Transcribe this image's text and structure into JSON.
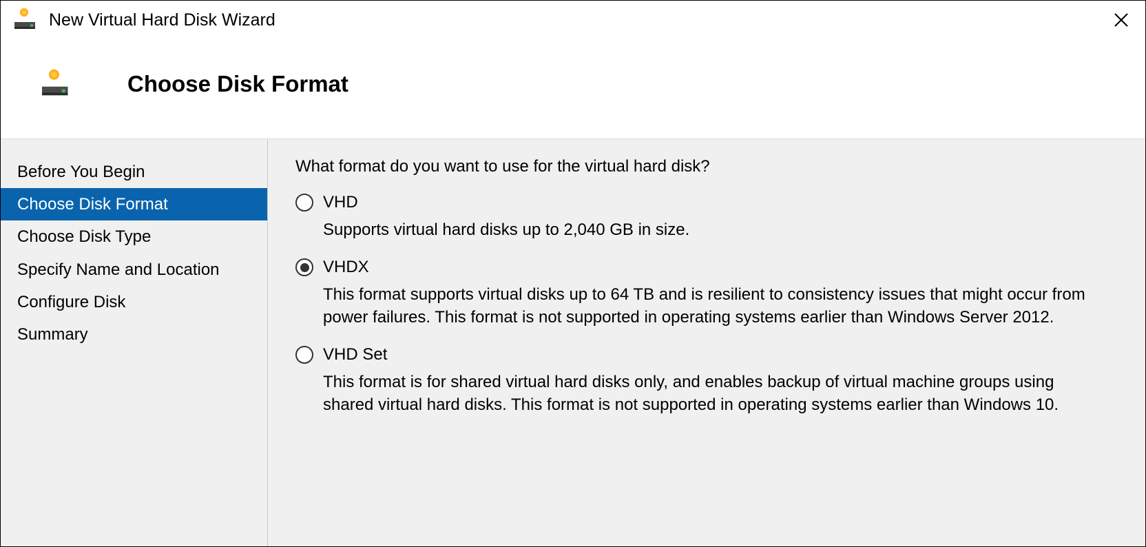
{
  "window": {
    "title": "New Virtual Hard Disk Wizard"
  },
  "header": {
    "heading": "Choose Disk Format"
  },
  "sidebar": {
    "steps": [
      {
        "label": "Before You Begin",
        "active": false
      },
      {
        "label": "Choose Disk Format",
        "active": true
      },
      {
        "label": "Choose Disk Type",
        "active": false
      },
      {
        "label": "Specify Name and Location",
        "active": false
      },
      {
        "label": "Configure Disk",
        "active": false
      },
      {
        "label": "Summary",
        "active": false
      }
    ]
  },
  "content": {
    "question": "What format do you want to use for the virtual hard disk?",
    "options": [
      {
        "id": "vhd",
        "label": "VHD",
        "description": "Supports virtual hard disks up to 2,040 GB in size.",
        "selected": false
      },
      {
        "id": "vhdx",
        "label": "VHDX",
        "description": "This format supports virtual disks up to 64 TB and is resilient to consistency issues that might occur from power failures. This format is not supported in operating systems earlier than Windows Server 2012.",
        "selected": true
      },
      {
        "id": "vhdset",
        "label": "VHD Set",
        "description": "This format is for shared virtual hard disks only, and enables backup of virtual machine groups using shared virtual hard disks. This format is not supported in operating systems earlier than Windows 10.",
        "selected": false
      }
    ]
  }
}
